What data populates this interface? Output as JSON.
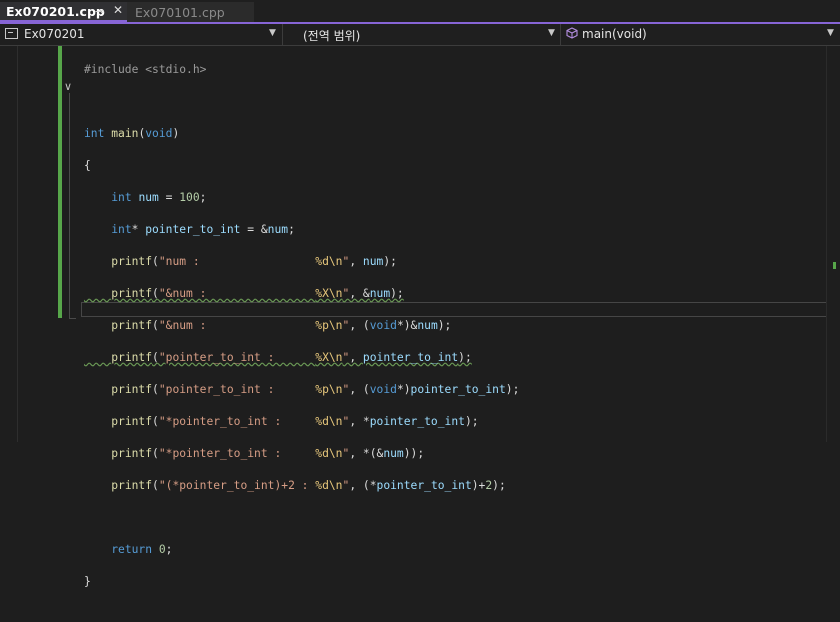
{
  "tabs": [
    {
      "label": "Ex070201.cpp",
      "active": true
    },
    {
      "label": "Ex070101.cpp",
      "active": false
    }
  ],
  "navbar": {
    "project": "Ex070201",
    "scope": "(전역 범위)",
    "member": "main(void)"
  },
  "colors": {
    "accent": "#8765d6",
    "change_bar": "#57a64a",
    "keyword": "#569cd6",
    "function": "#dcdcaa",
    "string": "#d69d85",
    "format_spec": "#e8c87c",
    "variable": "#9cdcfe",
    "number": "#b5cea8"
  },
  "code": {
    "l1_include": "#include <stdio.h>",
    "l3_int": "int",
    "l3_main": "main",
    "l3_open": "(",
    "l3_void": "void",
    "l3_close": ")",
    "l4": "{",
    "l5_int": "int",
    "l5_num": "num",
    "l5_eq": " = ",
    "l5_val": "100",
    "l5_semi": ";",
    "l6_int": "int",
    "l6_star": "* ",
    "l6_var": "pointer_to_int",
    "l6_eq": " = &",
    "l6_num": "num",
    "l6_semi": ";",
    "printf": "printf",
    "l7_str": "\"num :                 ",
    "l7_fmt": "%d\\n",
    "l7_end": "\"",
    "l7_args_a": ", ",
    "l7_arg": "num",
    "l7_args_b": ");",
    "l8_str": "\"&num :                ",
    "l8_fmt": "%X\\n",
    "l8_end": "\"",
    "l8_args_a": ", &",
    "l8_arg": "num",
    "l8_args_b": ");",
    "l9_str": "\"&num :                ",
    "l9_fmt": "%p\\n",
    "l9_end": "\"",
    "l9_args_a": ", (",
    "l9_void": "void",
    "l9_args_b": "*)&",
    "l9_arg": "num",
    "l9_args_c": ");",
    "l10_str": "\"pointer_to_int :      ",
    "l10_fmt": "%X\\n",
    "l10_end": "\"",
    "l10_args_a": ", ",
    "l10_arg": "pointer_to_int",
    "l10_args_b": ");",
    "l11_str": "\"pointer_to_int :      ",
    "l11_fmt": "%p\\n",
    "l11_end": "\"",
    "l11_args_a": ", (",
    "l11_void": "void",
    "l11_args_b": "*)",
    "l11_arg": "pointer_to_int",
    "l11_args_c": ");",
    "l12_str": "\"*pointer_to_int :     ",
    "l12_fmt": "%d\\n",
    "l12_end": "\"",
    "l12_args_a": ", *",
    "l12_arg": "pointer_to_int",
    "l12_args_b": ");",
    "l13_str": "\"*pointer_to_int :     ",
    "l13_fmt": "%d\\n",
    "l13_end": "\"",
    "l13_args_a": ", *(&",
    "l13_arg": "num",
    "l13_args_b": "));",
    "l14_str": "\"(*pointer_to_int)+2 : ",
    "l14_fmt": "%d\\n",
    "l14_end": "\"",
    "l14_args_a": ", (*",
    "l14_arg": "pointer_to_int",
    "l14_args_b": ")+",
    "l14_num": "2",
    "l14_args_c": ");",
    "l16_return": "return",
    "l16_val": "0",
    "l16_semi": ";",
    "l17": "}"
  }
}
